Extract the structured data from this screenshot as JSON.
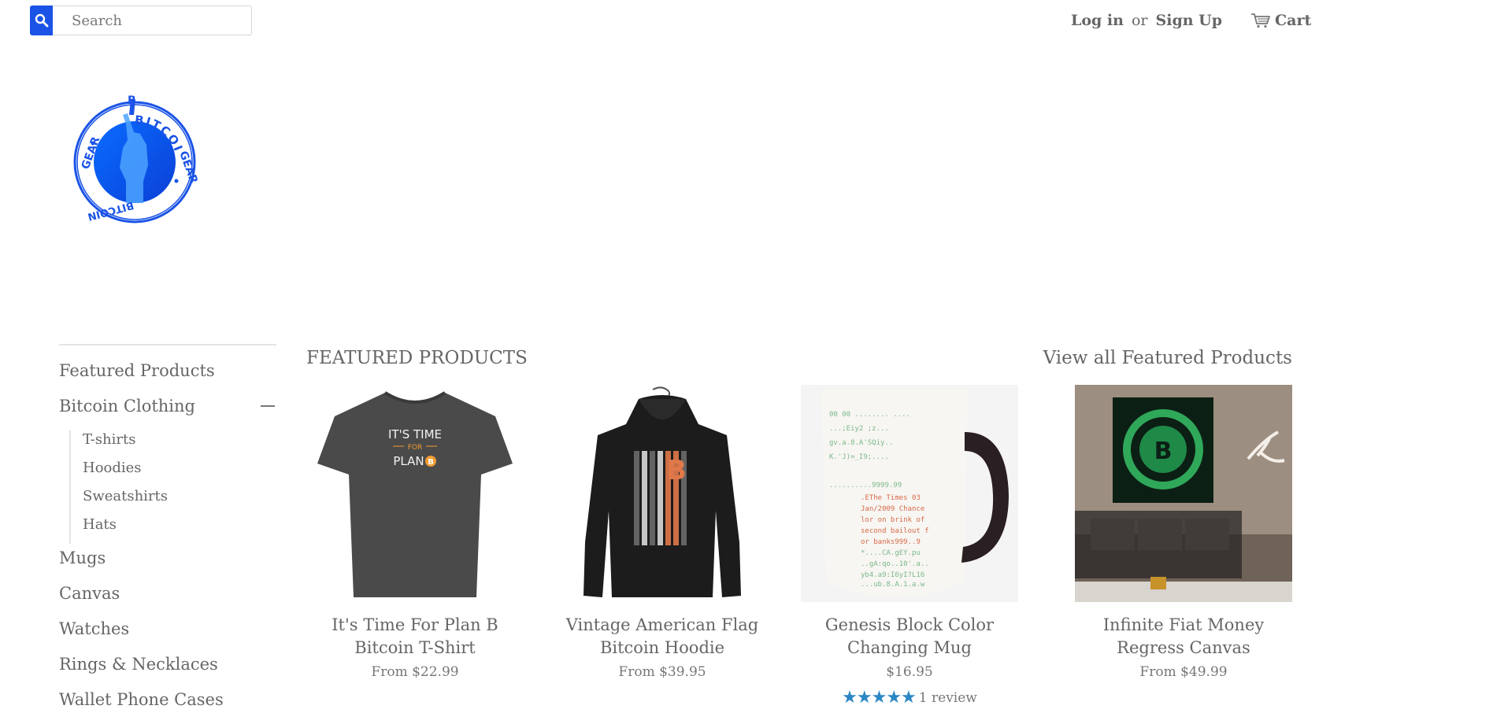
{
  "header": {
    "search_placeholder": "Search",
    "login_label": "Log in",
    "or_label": "or",
    "signup_label": "Sign Up",
    "cart_label": "Cart"
  },
  "logo": {
    "text_top": "BITCOIN",
    "text_left": "GEAR",
    "text_right": "GEAR",
    "text_bottom": "BITCOIN"
  },
  "sidebar": {
    "items": [
      {
        "label": "Featured Products"
      },
      {
        "label": "Bitcoin Clothing",
        "children": [
          {
            "label": "T-shirts"
          },
          {
            "label": "Hoodies"
          },
          {
            "label": "Sweatshirts"
          },
          {
            "label": "Hats"
          }
        ]
      },
      {
        "label": "Mugs"
      },
      {
        "label": "Canvas"
      },
      {
        "label": "Watches"
      },
      {
        "label": "Rings & Necklaces"
      },
      {
        "label": "Wallet Phone Cases"
      }
    ]
  },
  "main": {
    "section_title": "FEATURED PRODUCTS",
    "view_all_label": "View all Featured Products",
    "products": [
      {
        "name_line1": "It's Time For Plan B",
        "name_line2": "Bitcoin T-Shirt",
        "price": "From $22.99",
        "shirt_text1": "IT'S TIME",
        "shirt_text2": "FOR",
        "shirt_text3": "PLAN"
      },
      {
        "name_line1": "Vintage American Flag",
        "name_line2": "Bitcoin Hoodie",
        "price": "From $39.95"
      },
      {
        "name_line1": "Genesis Block Color",
        "name_line2": "Changing Mug",
        "price": "$16.95",
        "rating": 5,
        "review_label": "1 review"
      },
      {
        "name_line1": "Infinite Fiat Money",
        "name_line2": "Regress Canvas",
        "price": "From $49.99"
      }
    ]
  },
  "colors": {
    "accent": "#1a53e6",
    "text": "#666666",
    "star": "#2b87c4"
  }
}
